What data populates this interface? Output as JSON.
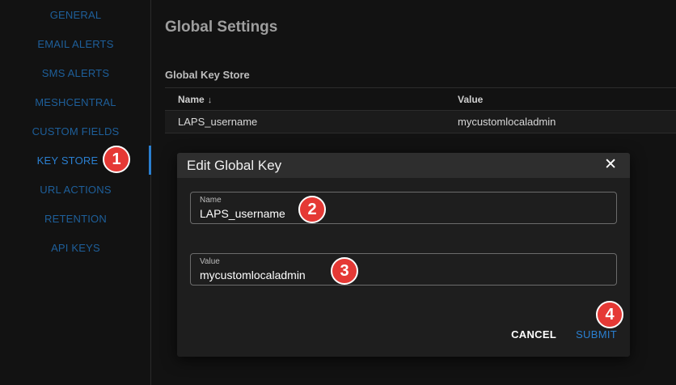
{
  "sidebar": {
    "items": [
      {
        "label": "GENERAL"
      },
      {
        "label": "EMAIL ALERTS"
      },
      {
        "label": "SMS ALERTS"
      },
      {
        "label": "MESHCENTRAL"
      },
      {
        "label": "CUSTOM FIELDS"
      },
      {
        "label": "KEY STORE"
      },
      {
        "label": "URL ACTIONS"
      },
      {
        "label": "RETENTION"
      },
      {
        "label": "API KEYS"
      }
    ]
  },
  "main": {
    "title": "Global Settings",
    "section_title": "Global Key Store",
    "table": {
      "columns": [
        "Name",
        "Value"
      ],
      "sort_icon": "↓",
      "rows": [
        {
          "name": "LAPS_username",
          "value": "mycustomlocaladmin"
        }
      ]
    }
  },
  "dialog": {
    "title": "Edit Global Key",
    "close_icon": "✕",
    "name_field": {
      "label": "Name",
      "value": "LAPS_username"
    },
    "value_field": {
      "label": "Value",
      "value": "mycustomlocaladmin"
    },
    "cancel_label": "CANCEL",
    "submit_label": "SUBMIT"
  },
  "steps": [
    "1",
    "2",
    "3",
    "4"
  ],
  "colors": {
    "accent": "#2a7fd0",
    "marker": "#e53935"
  }
}
